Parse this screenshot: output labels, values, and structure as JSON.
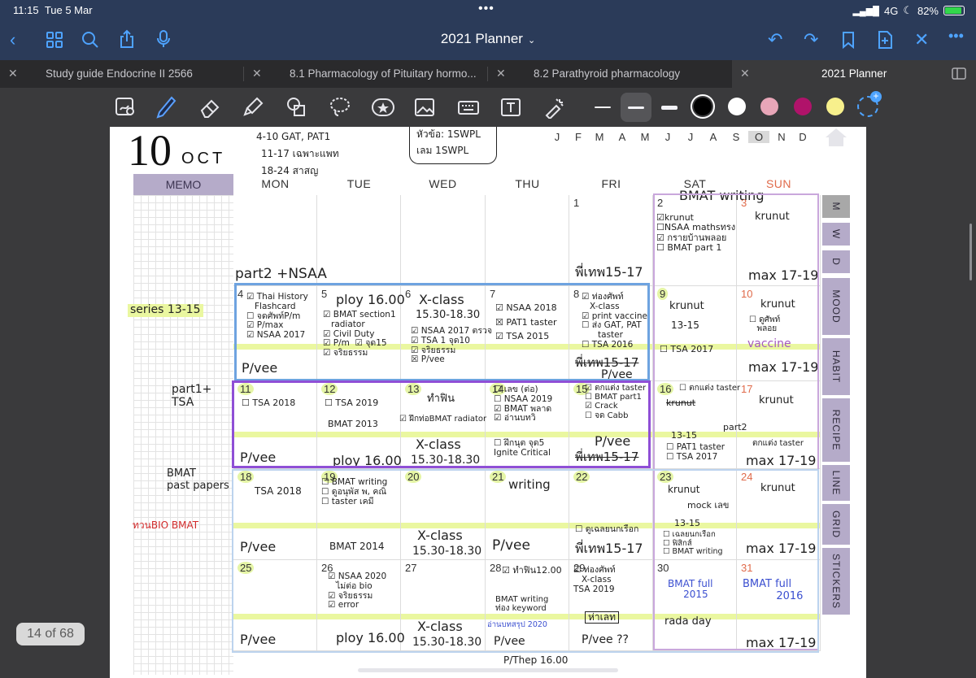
{
  "status": {
    "time": "11:15",
    "date": "Tue 5 Mar",
    "network": "4G",
    "battery": "82%",
    "battery_level": 0.82
  },
  "nav": {
    "title": "2021 Planner"
  },
  "tabs": [
    {
      "label": "Study guide Endocrine II 2566"
    },
    {
      "label": "8.1 Pharmacology of Pituitary hormo..."
    },
    {
      "label": "8.2 Parathyroid pharmacology"
    },
    {
      "label": "2021 Planner"
    }
  ],
  "colors": {
    "chrome": "#2b3b59",
    "accent": "#4ea3ff",
    "lavender": "#b5abc9",
    "highlighter": "#eaf7a0",
    "swatches": [
      "#000000",
      "#ffffff",
      "#e8a6b8",
      "#b0136a",
      "#f7f08c"
    ]
  },
  "page_indicator": "14 of 68",
  "planner": {
    "day": "10",
    "month": "OCT",
    "months": [
      "J",
      "F",
      "M",
      "A",
      "M",
      "J",
      "J",
      "A",
      "S",
      "O",
      "N",
      "D"
    ],
    "memo_label": "MEMO",
    "weekdays": [
      "MON",
      "TUE",
      "WED",
      "THU",
      "FRI",
      "SAT",
      "SUN"
    ],
    "dates": [
      [
        "",
        "",
        "",
        "",
        "1",
        "2",
        "3"
      ],
      [
        "4",
        "5",
        "6",
        "7",
        "8",
        "9",
        "10"
      ],
      [
        "11",
        "12",
        "13",
        "14",
        "15",
        "16",
        "17"
      ],
      [
        "18",
        "19",
        "20",
        "21",
        "22",
        "23",
        "24"
      ],
      [
        "25",
        "26",
        "27",
        "28",
        "29",
        "30",
        "31"
      ]
    ],
    "side_tabs": [
      "M",
      "W",
      "D",
      "MOOD",
      "HABIT",
      "RECIPE",
      "LINE",
      "GRID",
      "STICKERS"
    ],
    "notes": {
      "top_left": [
        "4-10  GAT, PAT1",
        "11-17  เฉพาะแพท",
        "18-24 สาสญ"
      ],
      "top_box": [
        "หัวข้อ: 1SWPL",
        "เลม 1SWPL"
      ],
      "memo_series": "series 13-15",
      "memo_part1": "part1+\nTSA",
      "memo_bmat": "BMAT\npast papers",
      "memo_bio": "ทวนBIO BMAT",
      "w1_mon": "part2 +NSAA",
      "w1_fri": "พี่เทพ15-17",
      "w1_sat_title": "BMAT writing",
      "w1_sat": "☑krunut\n☐NSAA mathsทรง\n☑ กรายบ้านพลอย\n☐ BMAT part 1",
      "w1_sun": "krunut",
      "w1_sun2": "max 17-19",
      "w2_mon": "☑ Thai History\n   Flashcard\n☐ จดศัพท์P/m\n☑ P/max\n☑ NSAA 2017",
      "w2_mon2": "P/vee",
      "w2_tue": "ploy 16.00",
      "w2_tue_list": "☑ BMAT section1\n   radiator\n☑ Civil Duty\n☑ P/m  ☑ จุด15\n☑ จริยธรรม",
      "w2_wed": "X-class",
      "w2_wed_time": "15.30-18.30",
      "w2_wed_list": "☑ NSAA 2017 ตรวจ\n☑ TSA 1 จุด10\n☑ จริยธรรม\n☒ P/vee",
      "w2_thu": "☑ NSAA 2018\n☒ PAT1 taster\n☑ TSA 2015",
      "w2_fri": "☑ ท่องศัพท์\n   X-class\n☑ print vaccine\n☐ ส่ง GAT, PAT\n      taster\n☐ TSA 2016",
      "w2_fri2": "พี่เทพ15-17",
      "w2_fri3": "P/vee",
      "w2_sat": "krunut",
      "w2_sat2": "13-15",
      "w2_sat3": "☐ TSA 2017",
      "w2_sun": "krunut",
      "w2_sun_list": "☐ ดูศัพท์\n   พลอย",
      "w2_sun_vaccine": "vaccine",
      "w2_sun2": "max 17-19",
      "w3_mon": "☐ TSA 2018",
      "w3_mon2": "P/vee",
      "w3_tue": "☐ TSA 2019",
      "w3_tue2": "BMAT 2013",
      "w3_tue3": "ploy 16.00",
      "w3_wed": "ทำฟิน",
      "w3_wed_list": "☑ ฝึกท่อBMAT radiator",
      "w3_wed2": "X-class",
      "w3_wed3": "15.30-18.30",
      "w3_thu": "☐ เลข (ต่อ)\n☐ NSAA 2019\n☑ BMAT พลาด\n☑ อ่านบทวิ",
      "w3_thu2": "☐ ฝึกนุต จุด5\nIgnite Critical",
      "w3_fri": "☑ ตกแต่ง taster\n☐ BMAT part1 \n☑ Crack\n☐ จด Cabb",
      "w3_fri2": "P/vee",
      "w3_fri3": "พี่เทพ15-17",
      "w3_sat": "☐ ตกแต่ง taster",
      "w3_sat_strike": "krunut",
      "w3_sat2": "13-15",
      "w3_sat3": "☐ PAT1 taster\n☐ TSA 2017",
      "w3_sun_part2": "part2",
      "w3_sun": "krunut",
      "w3_sun_list": "ตกแต่ง taster",
      "w3_sun2": "max 17-19",
      "w4_mon": "TSA 2018",
      "w4_mon2": "P/vee",
      "w4_tue": "☐ BMAT writing\n☐ ดูอนุพัส พ, คณิ\n☐ taster เคมี",
      "w4_tue2": "BMAT 2014",
      "w4_wed": "X-class",
      "w4_wed2": "15.30-18.30",
      "w4_thu": "writing",
      "w4_thu2": "P/vee",
      "w4_fri": "☐ ดูเฉลยนกเรือก",
      "w4_fri2": "พี่เทพ15-17",
      "w4_sat": "krunut",
      "w4_sat_sub": "mock เลข",
      "w4_sat2": "13-15",
      "w4_sat3": "☐ เฉลยนกเรือก\n☐ ฟิสิกส์\n☐ BMAT writing",
      "w4_sun": "krunut",
      "w4_sun2": "max 17-19",
      "w5_mon": "P/vee",
      "w5_tue": "☑ NSAA 2020\n   ไม่ต่อ bio\n☑ จริยธรรม\n☑ error",
      "w5_tue2": "ploy 16.00",
      "w5_wed": "X-class",
      "w5_wed2": "15.30-18.30",
      "w5_thu": "☑ ทำฟิน12.00",
      "w5_thu2": "BMAT writing\nท่อง keyword",
      "w5_thu3": "อ่านบทสรุป 2020",
      "w5_thu4": "P/vee",
      "w5_thu5": "P/Thep 16.00",
      "w5_fri": "☑ ท่องศัพท์\n   X-class\nTSA 2019",
      "w5_fri2": "ห่าเลท",
      "w5_fri3": "P/vee ??",
      "w5_sat": "BMAT full\n     2015",
      "w5_sat2": "rada day",
      "w5_sun": "BMAT full\n          2016",
      "w5_sun2": "max 17-19"
    }
  }
}
